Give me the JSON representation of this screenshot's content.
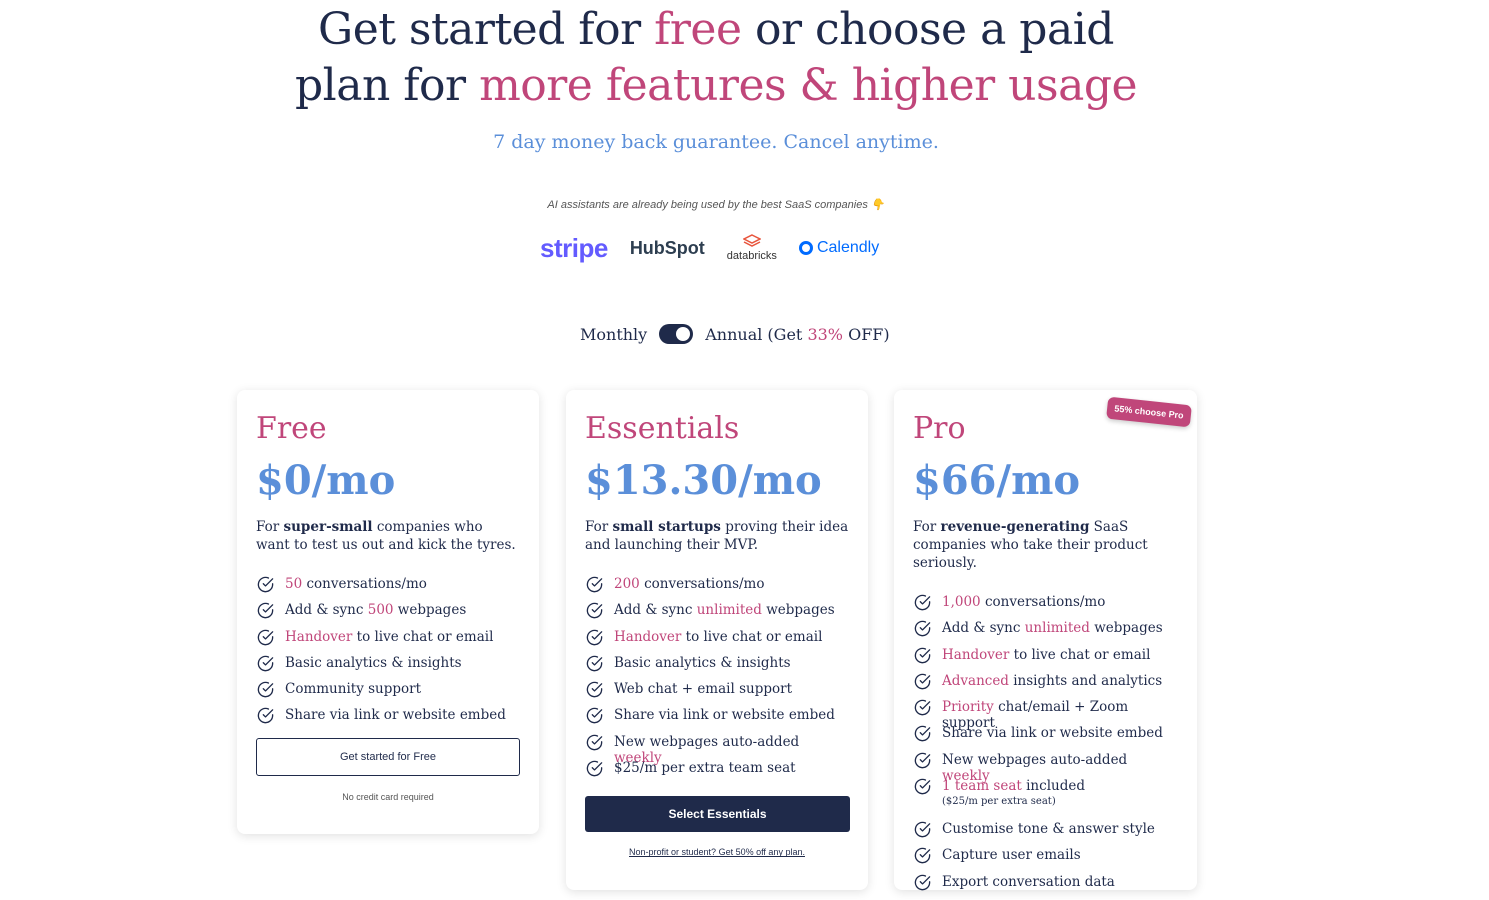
{
  "headline": {
    "line1_a": "Get started for ",
    "line1_b": "free",
    "line1_c": " or choose a paid",
    "line2_a": "plan for ",
    "line2_b": "more features & higher usage"
  },
  "subhead": "7 day money back guarantee. Cancel anytime.",
  "social_proof": {
    "text": "AI assistants are already being used by the best SaaS companies 👇",
    "logos": [
      "stripe",
      "HubSpot",
      "databricks",
      "Calendly"
    ]
  },
  "billing": {
    "monthly_label": "Monthly",
    "annual_label_a": "Annual (Get ",
    "annual_discount": "33%",
    "annual_label_b": " OFF)"
  },
  "plans": {
    "free": {
      "name": "Free",
      "price": "$0/mo",
      "desc_a": "For ",
      "desc_b": "super-small",
      "desc_c": " companies who want to test us out and kick the tyres.",
      "features": [
        {
          "hl": "50",
          "rest": " conversations/mo"
        },
        {
          "pre": "Add & sync ",
          "hl": "500",
          "rest": " webpages"
        },
        {
          "hl": "Handover",
          "rest": " to live chat or email"
        },
        {
          "rest": "Basic analytics & insights"
        },
        {
          "rest": "Community support"
        },
        {
          "rest": "Share via link or website embed"
        }
      ],
      "cta": "Get started for Free",
      "note": "No credit card required"
    },
    "essentials": {
      "name": "Essentials",
      "price": "$13.30/mo",
      "desc_a": "For ",
      "desc_b": "small startups",
      "desc_c": " proving their idea and launching their MVP.",
      "features": [
        {
          "hl": "200",
          "rest": " conversations/mo"
        },
        {
          "pre": "Add & sync ",
          "hl": "unlimited",
          "rest": " webpages"
        },
        {
          "hl": "Handover",
          "rest": " to live chat or email"
        },
        {
          "rest": "Basic analytics & insights"
        },
        {
          "rest": "Web chat + email support"
        },
        {
          "rest": "Share via link or website embed"
        },
        {
          "pre": "New webpages auto-added ",
          "hl": "weekly"
        },
        {
          "rest": "$25/m per extra team seat"
        }
      ],
      "cta": "Select Essentials",
      "note": "Non-profit or student? Get 50% off any plan."
    },
    "pro": {
      "name": "Pro",
      "price": "$66/mo",
      "badge": "55% choose Pro",
      "desc_a": "For ",
      "desc_b": "revenue-generating",
      "desc_c": " SaaS companies who take their product seriously.",
      "features": [
        {
          "hl": "1,000",
          "rest": " conversations/mo"
        },
        {
          "pre": "Add & sync ",
          "hl": "unlimited",
          "rest": " webpages"
        },
        {
          "hl": "Handover",
          "rest": " to live chat or email"
        },
        {
          "hl": "Advanced",
          "rest": " insights and analytics"
        },
        {
          "hl": "Priority",
          "rest": " chat/email + Zoom support"
        },
        {
          "rest": "Share via link or website embed"
        },
        {
          "pre": "New webpages auto-added ",
          "hl": "weekly"
        },
        {
          "hl": "1 team seat",
          "rest": " included",
          "small": "($25/m per extra seat)"
        },
        {
          "rest": "Customise tone & answer style"
        },
        {
          "rest": "Capture user emails"
        },
        {
          "rest": "Export conversation data"
        }
      ]
    }
  },
  "colors": {
    "navy": "#1f2a4a",
    "pink": "#c0467a",
    "blue": "#5b8fd9"
  }
}
